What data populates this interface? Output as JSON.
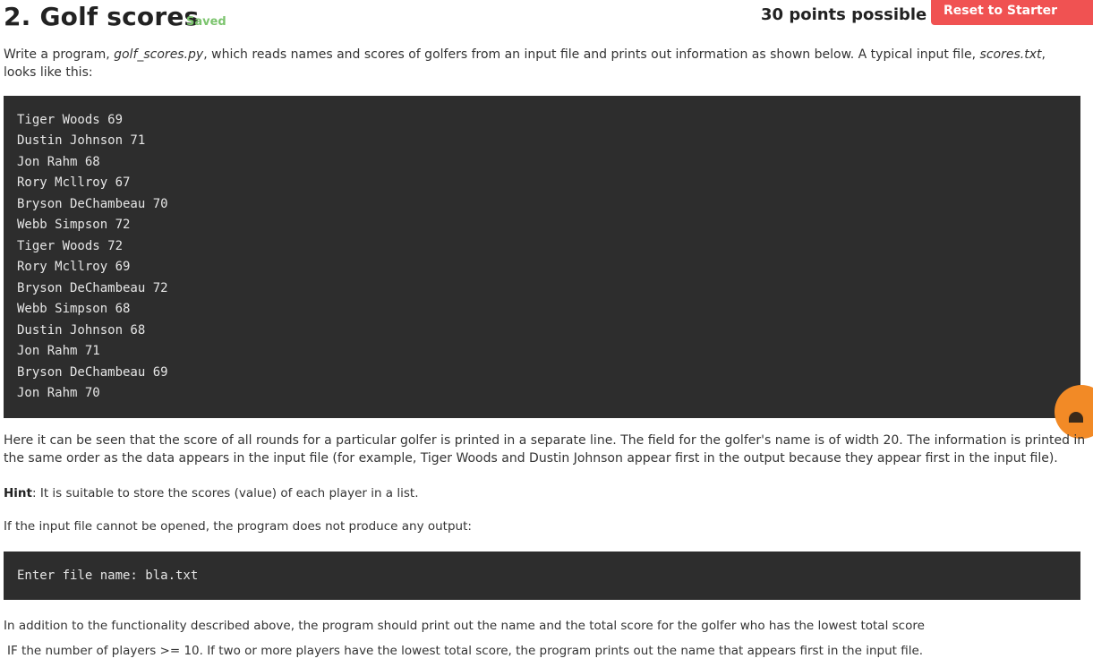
{
  "header": {
    "title": "2. Golf scores",
    "saved": "Saved",
    "points": "30 points possible",
    "reset_label": "Reset to Starter Code"
  },
  "intro": {
    "p1_a": "Write a program, ",
    "p1_file": "golf_scores.py",
    "p1_b": ", which reads names and scores of golfers from an input file and prints out information as shown below. A typical input file, ",
    "p1_input": "scores.txt",
    "p1_c": ",",
    "p1_line2": "looks like this:"
  },
  "input_file_lines": [
    "Tiger Woods 69",
    "Dustin Johnson 71",
    "Jon Rahm 68",
    "Rory Mcllroy 67",
    "Bryson DeChambeau 70",
    "Webb Simpson 72",
    "Tiger Woods 72",
    "Rory Mcllroy 69",
    "Bryson DeChambeau 72",
    "Webb Simpson 68",
    "Dustin Johnson 68",
    "Jon Rahm 71",
    "Bryson DeChambeau 69",
    "Jon Rahm 70"
  ],
  "explain": {
    "line1": "Here it can be seen that the score of all rounds for a particular golfer is printed in a separate line.  The field for the golfer's name is of width 20.  The information is printed in",
    "line2": "the same order as the data appears in the input file (for example, Tiger Woods and Dustin Johnson appear first in the output because they appear first in the input file)."
  },
  "hint": {
    "label": "Hint",
    "text": ":   It is suitable to store the scores (value) of each player in a list."
  },
  "no_output": "If the input file cannot be opened, the program does not produce any output:",
  "error_example": "Enter file name: bla.txt",
  "additional": {
    "line1": "In addition to the functionality described above, the  program should print out the name and the total score for the golfer who has  the lowest total score",
    "line2": "IF the number of players >= 10.  If two or more players have the lowest total score, the program prints out the name that appears first in the input file."
  }
}
